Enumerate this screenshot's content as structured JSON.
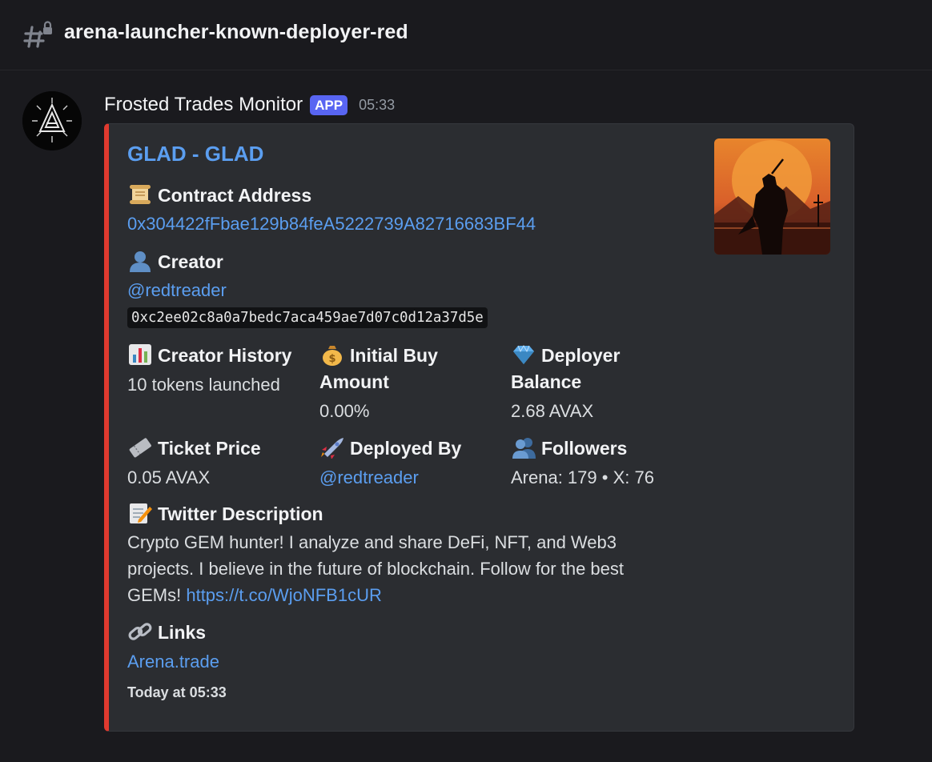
{
  "channel": {
    "name": "arena-launcher-known-deployer-red",
    "icon": "hash-lock-icon"
  },
  "message": {
    "author": "Frosted Trades Monitor",
    "badge": "APP",
    "time": "05:33",
    "accent_color": "#e03a2f"
  },
  "embed": {
    "title": "GLAD - GLAD",
    "contract": {
      "label": "Contract Address",
      "icon": "scroll-icon",
      "value": "0x304422fFbae129b84feA5222739A82716683BF44"
    },
    "creator": {
      "label": "Creator",
      "icon": "person-icon",
      "handle": "@redtreader",
      "address": "0xc2ee02c8a0a7bedc7aca459ae7d07c0d12a37d5e"
    },
    "creator_history": {
      "label": "Creator History",
      "icon": "bar-chart-icon",
      "value": "10 tokens launched"
    },
    "initial_buy": {
      "label_line1": "Initial Buy",
      "label_line2": "Amount",
      "icon": "money-bag-icon",
      "value": "0.00%"
    },
    "deployer_balance": {
      "label_line1": "Deployer",
      "label_line2": "Balance",
      "icon": "gem-icon",
      "value": "2.68 AVAX"
    },
    "ticket_price": {
      "label": "Ticket Price",
      "icon": "ticket-icon",
      "value": "0.05 AVAX"
    },
    "deployed_by": {
      "label": "Deployed By",
      "icon": "rocket-icon",
      "value": "@redtreader"
    },
    "followers": {
      "label": "Followers",
      "icon": "people-icon",
      "value": "Arena: 179 • X: 76"
    },
    "twitter": {
      "label": "Twitter Description",
      "icon": "memo-icon",
      "line1": "Crypto GEM hunter! I analyze and share DeFi, NFT, and Web3",
      "line2": "projects. I believe in the future of blockchain. Follow for the best",
      "line3_text": "GEMs! ",
      "line3_link": "https://t.co/WjoNFB1cUR"
    },
    "links": {
      "label": "Links",
      "icon": "link-icon",
      "value": "Arena.trade"
    },
    "footer": "Today at 05:33"
  }
}
